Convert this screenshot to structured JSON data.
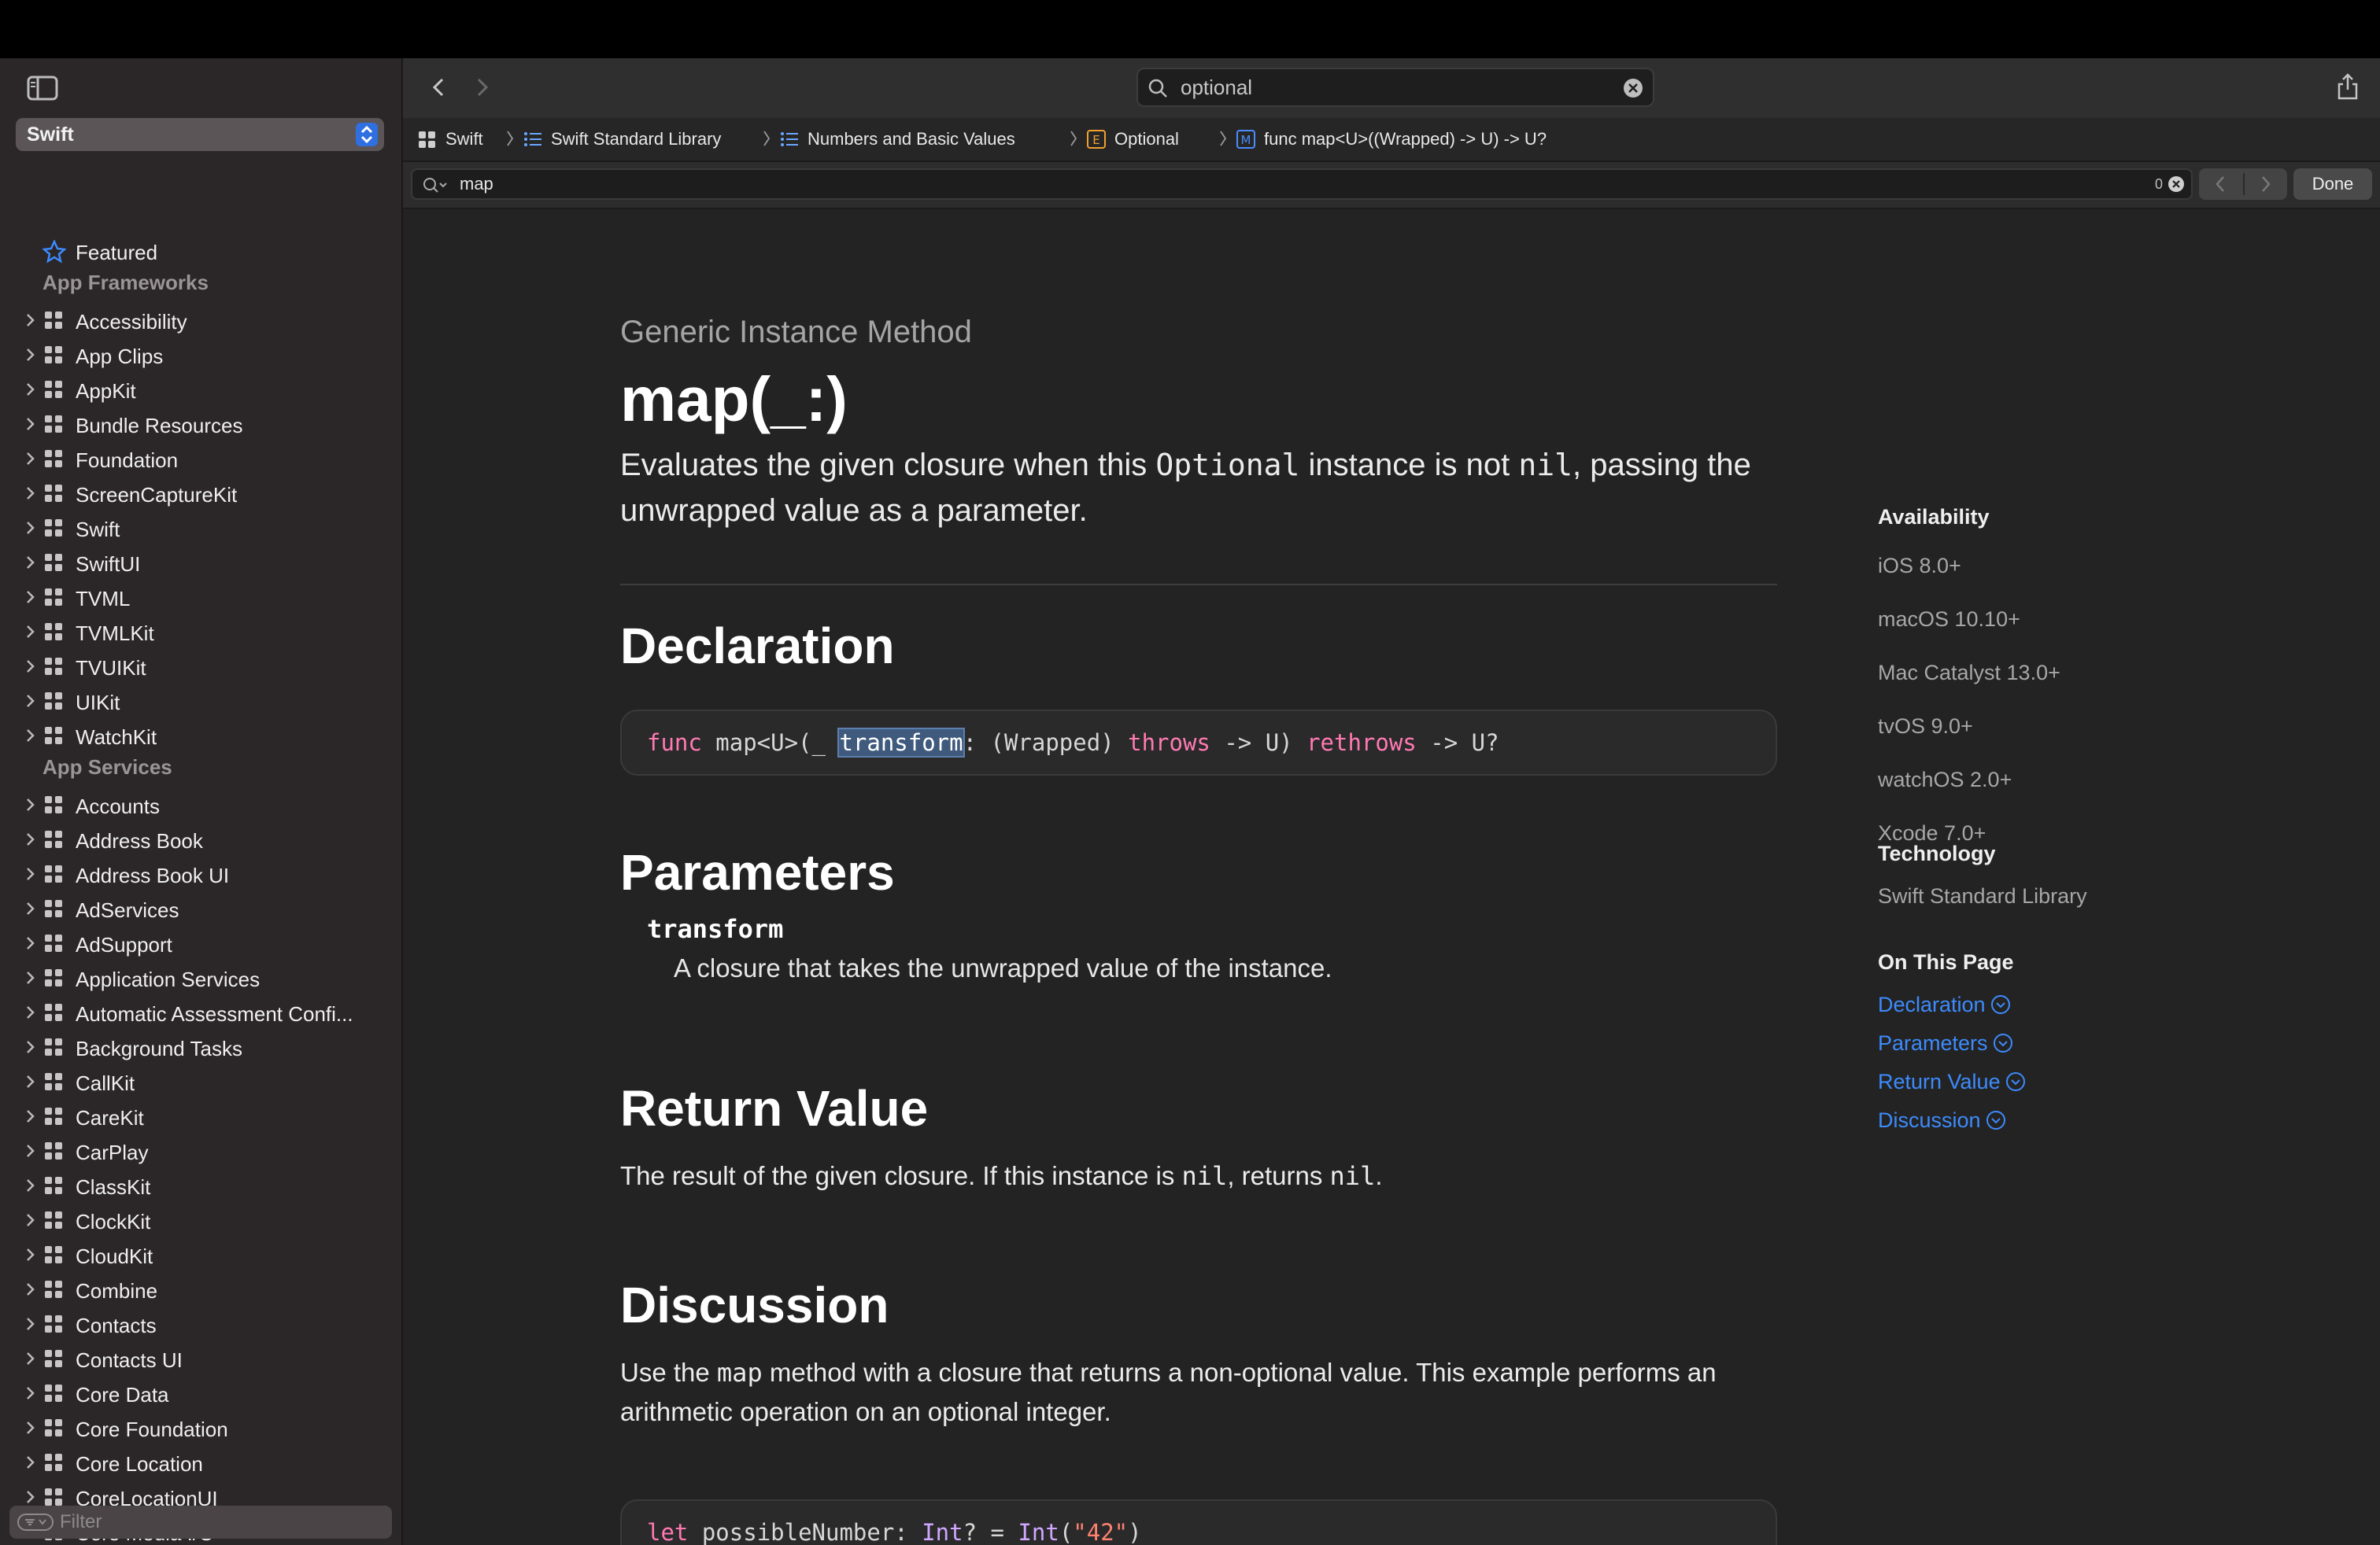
{
  "sidebar": {
    "technology": "Swift",
    "featured": "Featured",
    "sections": [
      {
        "heading": "App Frameworks",
        "items": [
          "Accessibility",
          "App Clips",
          "AppKit",
          "Bundle Resources",
          "Foundation",
          "ScreenCaptureKit",
          "Swift",
          "SwiftUI",
          "TVML",
          "TVMLKit",
          "TVUIKit",
          "UIKit",
          "WatchKit"
        ]
      },
      {
        "heading": "App Services",
        "items": [
          "Accounts",
          "Address Book",
          "Address Book UI",
          "AdServices",
          "AdSupport",
          "Application Services",
          "Automatic Assessment Confi...",
          "Background Tasks",
          "CallKit",
          "CareKit",
          "CarPlay",
          "ClassKit",
          "ClockKit",
          "CloudKit",
          "Combine",
          "Contacts",
          "Contacts UI",
          "Core Data",
          "Core Foundation",
          "Core Location",
          "CoreLocationUI",
          "Core Media I/O"
        ]
      }
    ],
    "filter_placeholder": "Filter"
  },
  "toolbar": {
    "search_value": "optional"
  },
  "breadcrumb": [
    {
      "label": "Swift",
      "icon": "framework-icon"
    },
    {
      "label": "Swift Standard Library",
      "icon": "list-icon"
    },
    {
      "label": "Numbers and Basic Values",
      "icon": "list-icon"
    },
    {
      "label": "Optional",
      "icon": "enum-icon",
      "badge": "E"
    },
    {
      "label": "func map<U>((Wrapped) -> U) -> U?",
      "icon": "method-icon",
      "badge": "M"
    }
  ],
  "find": {
    "query": "map",
    "count": "0",
    "done_label": "Done"
  },
  "article": {
    "eyebrow": "Generic Instance Method",
    "title": "map(_:)",
    "abstract": {
      "t1": "Evaluates the given closure when this ",
      "c1": "Optional",
      "t2": " instance is not ",
      "c2": "nil",
      "t3": ", passing the unwrapped value as a parameter."
    },
    "declaration": {
      "heading": "Declaration",
      "code": {
        "func": "func",
        "name": " map<U>(_ ",
        "param": "transform",
        "mid": ": (Wrapped) ",
        "throws": "throws",
        "arrow1": " -> U) ",
        "rethrows": "rethrows",
        "arrow2": " -> U?"
      }
    },
    "parameters": {
      "heading": "Parameters",
      "name": "transform",
      "description": "A closure that takes the unwrapped value of the instance."
    },
    "return_value": {
      "heading": "Return Value",
      "t1": "The result of the given closure. If this instance is ",
      "c1": "nil",
      "t2": ", returns ",
      "c2": "nil",
      "t3": "."
    },
    "discussion": {
      "heading": "Discussion",
      "t1": "Use the ",
      "c1": "map",
      "t2": " method with a closure that returns a non-optional value. This example performs an arithmetic operation on an optional integer.",
      "code": {
        "let": "let",
        "name": " possibleNumber: ",
        "type1": "Int",
        "mid": "? = ",
        "type2": "Int",
        "open": "(",
        "str": "\"42\"",
        "close": ")"
      }
    }
  },
  "aside": {
    "availability_heading": "Availability",
    "availability": [
      "iOS 8.0+",
      "macOS 10.10+",
      "Mac Catalyst 13.0+",
      "tvOS 9.0+",
      "watchOS 2.0+",
      "Xcode 7.0+"
    ],
    "technology_heading": "Technology",
    "technology": "Swift Standard Library",
    "on_this_page_heading": "On This Page",
    "on_this_page": [
      "Declaration",
      "Parameters",
      "Return Value",
      "Discussion"
    ]
  },
  "colors": {
    "accent": "#3d8bfd",
    "sidebar_bg": "#2b2628",
    "content_bg": "#232323",
    "keyword": "#ff7ab2",
    "type": "#d0a8ff",
    "string": "#ff8170"
  }
}
